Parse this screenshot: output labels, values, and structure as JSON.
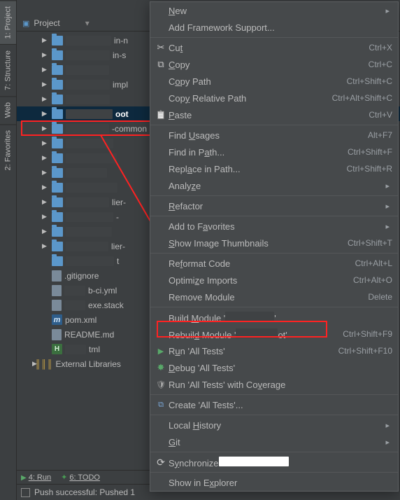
{
  "sidebar_tabs": [
    "1: Project",
    "7: Structure",
    "Web",
    "2: Favorites"
  ],
  "project_header": {
    "label": "Project"
  },
  "tree": {
    "items": [
      {
        "k": "dir",
        "label": "in-n"
      },
      {
        "k": "dir",
        "label": "in-s"
      },
      {
        "k": "dir",
        "label": ""
      },
      {
        "k": "dir",
        "label": "impl"
      },
      {
        "k": "dir",
        "label": ""
      },
      {
        "k": "dir",
        "label": "oot",
        "selected": true
      },
      {
        "k": "dir",
        "label": "-common"
      },
      {
        "k": "dir",
        "label": ""
      },
      {
        "k": "dir",
        "label": ""
      },
      {
        "k": "dir",
        "label": ""
      },
      {
        "k": "dir",
        "label": ""
      },
      {
        "k": "dir",
        "label": "lier-"
      },
      {
        "k": "dir",
        "label": "-"
      },
      {
        "k": "dir",
        "label": ""
      },
      {
        "k": "dir",
        "label": "lier-"
      },
      {
        "k": "dir",
        "label": "t",
        "no_arrow": true
      },
      {
        "k": "file",
        "label": ".gitignore"
      },
      {
        "k": "file",
        "label": "b-ci.yml"
      },
      {
        "k": "file",
        "label": "exe.stack"
      },
      {
        "k": "maven",
        "label": "pom.xml"
      },
      {
        "k": "file",
        "label": "README.md"
      },
      {
        "k": "html",
        "label": "tml"
      }
    ],
    "ext_lib": "External Libraries"
  },
  "bottom": {
    "run": "4: Run",
    "todo": "6: TODO"
  },
  "status": "Push successful: Pushed 1",
  "ctx": {
    "groups": [
      [
        {
          "label_pre": "",
          "u": "N",
          "label_post": "ew",
          "sub": "arrow"
        },
        {
          "label_pre": "Add Framework Support...",
          "u": "",
          "label_post": ""
        }
      ],
      [
        {
          "icon": "i-scissor",
          "label_pre": "Cu",
          "u": "t",
          "label_post": "",
          "sc": "Ctrl+X"
        },
        {
          "icon": "i-copy",
          "label_pre": "",
          "u": "C",
          "label_post": "opy",
          "sc": "Ctrl+C"
        },
        {
          "label_pre": "C",
          "u": "o",
          "label_post": "py Path",
          "sc": "Ctrl+Shift+C"
        },
        {
          "label_pre": "Cop",
          "u": "y",
          "label_post": " Relative Path",
          "sc": "Ctrl+Alt+Shift+C"
        },
        {
          "icon": "i-clip",
          "label_pre": "",
          "u": "P",
          "label_post": "aste",
          "sc": "Ctrl+V"
        }
      ],
      [
        {
          "label_pre": "Find ",
          "u": "U",
          "label_post": "sages",
          "sc": "Alt+F7"
        },
        {
          "label_pre": "Find in P",
          "u": "a",
          "label_post": "th...",
          "sc": "Ctrl+Shift+F"
        },
        {
          "label_pre": "Repl",
          "u": "a",
          "label_post": "ce in Path...",
          "sc": "Ctrl+Shift+R"
        },
        {
          "label_pre": "Analy",
          "u": "z",
          "label_post": "e",
          "sub": "arrow"
        }
      ],
      [
        {
          "label_pre": "",
          "u": "R",
          "label_post": "efactor",
          "sub": "arrow"
        }
      ],
      [
        {
          "label_pre": "Add to F",
          "u": "a",
          "label_post": "vorites",
          "sub": "arrow"
        },
        {
          "label_pre": "",
          "u": "S",
          "label_post": "how Image Thumbnails",
          "sc": "Ctrl+Shift+T"
        }
      ],
      [
        {
          "label_pre": "Re",
          "u": "f",
          "label_post": "ormat Code",
          "sc": "Ctrl+Alt+L"
        },
        {
          "label_pre": "Optimi",
          "u": "z",
          "label_post": "e Imports",
          "sc": "Ctrl+Alt+O"
        },
        {
          "label_pre": "Remove Module",
          "u": "",
          "label_post": "",
          "sc": "Delete"
        }
      ],
      [
        {
          "label_pre": "Build ",
          "u": "M",
          "label_post": "odule '",
          "tail_redact": 70,
          "tail_after": "'",
          "hl": true
        },
        {
          "label_pre": "Rebuil",
          "u": "d",
          "label_post": " Module '",
          "tail_redact": 60,
          "tail_after": "ot'",
          "sc": "Ctrl+Shift+F9"
        },
        {
          "icon": "i-run",
          "label_pre": "R",
          "u": "u",
          "label_post": "n 'All Tests'",
          "sc": "Ctrl+Shift+F10"
        },
        {
          "icon": "i-bug",
          "label_pre": "",
          "u": "D",
          "label_post": "ebug 'All Tests'"
        },
        {
          "icon": "i-shield",
          "label_pre": "Run 'All Tests' with Co",
          "u": "v",
          "label_post": "erage"
        }
      ],
      [
        {
          "icon": "i-new",
          "label_pre": "Create 'All Tests'...",
          "u": "",
          "label_post": ""
        }
      ],
      [
        {
          "label_pre": "Local ",
          "u": "H",
          "label_post": "istory",
          "sub": "arrow"
        },
        {
          "label_pre": "",
          "u": "G",
          "label_post": "it",
          "sub": "arrow"
        }
      ],
      [
        {
          "icon": "i-refresh",
          "label_pre": "S",
          "u": "y",
          "label_post": "nchronize",
          "tail_redact": 100,
          "tail_white": true
        }
      ],
      [
        {
          "label_pre": "Show in E",
          "u": "x",
          "label_post": "plorer"
        }
      ]
    ]
  }
}
